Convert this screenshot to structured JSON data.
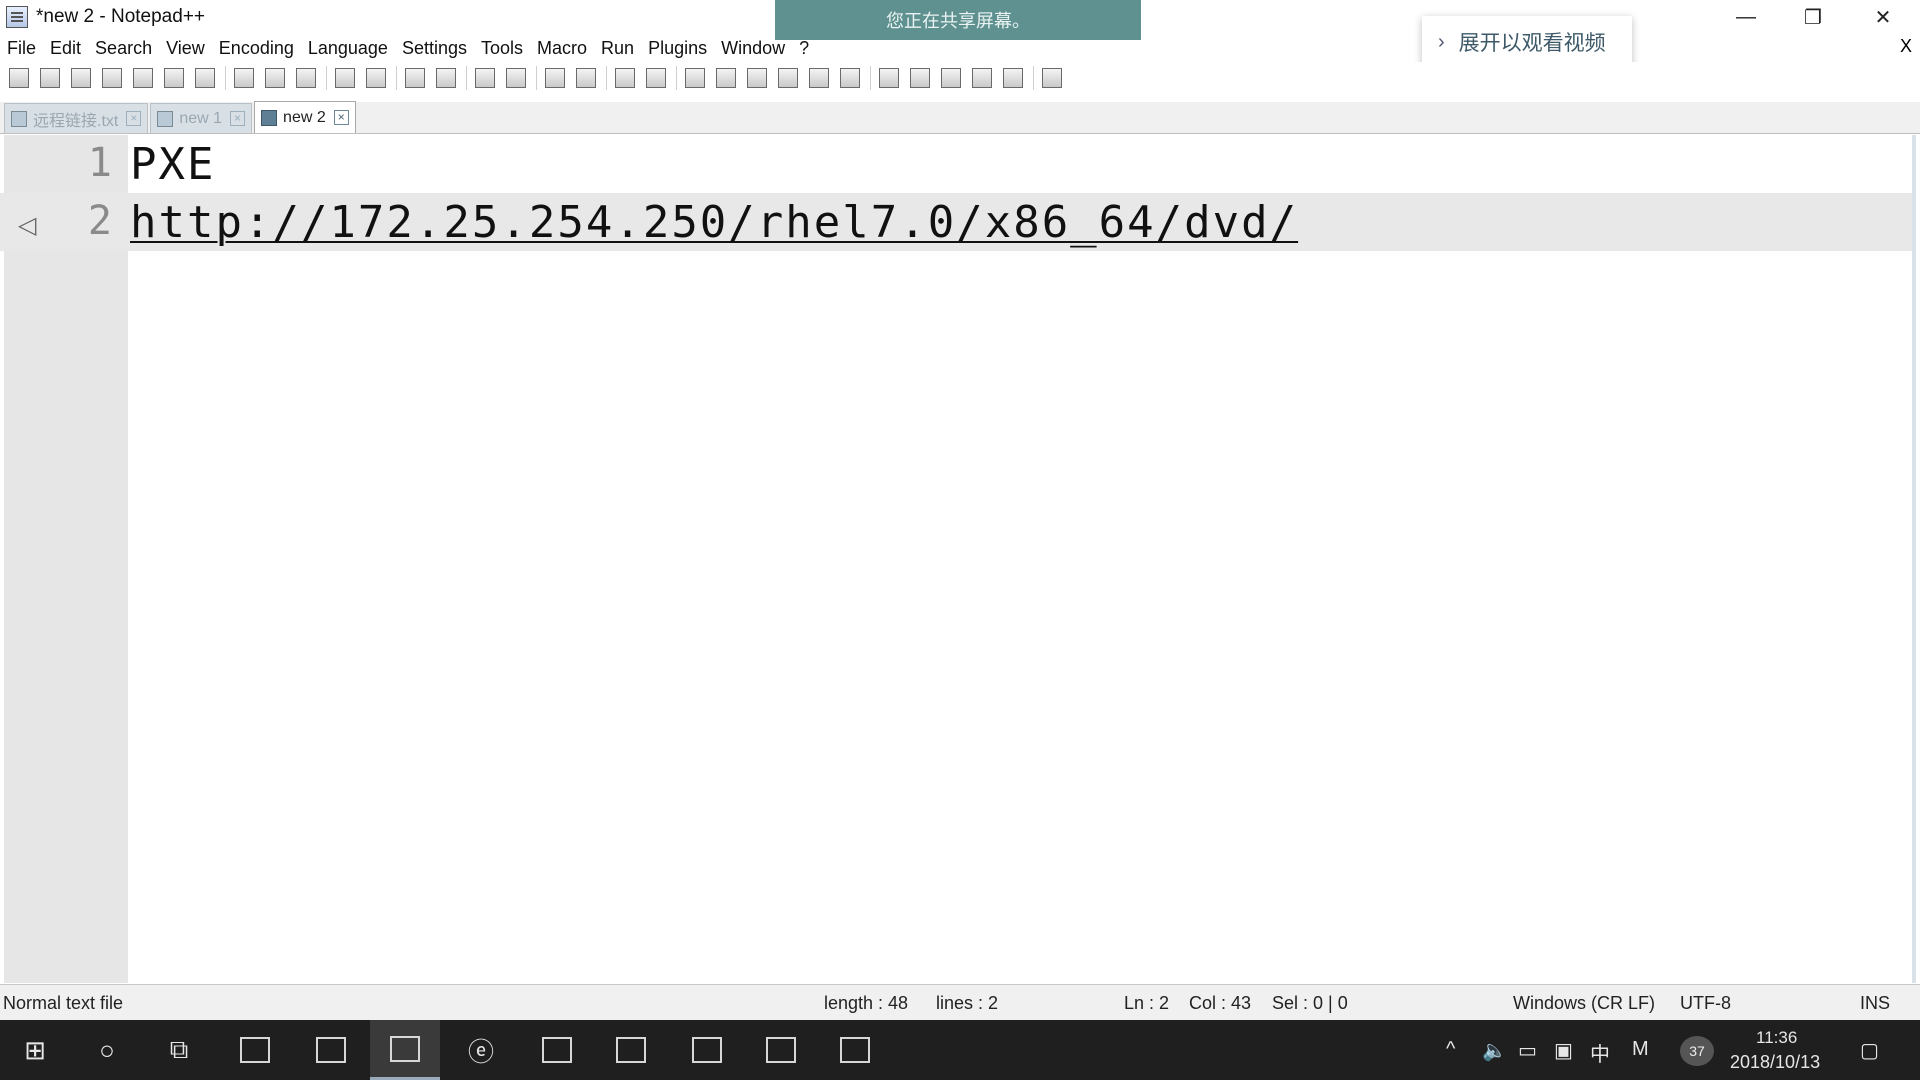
{
  "window": {
    "title": "*new 2 - Notepad++",
    "share_banner": "您正在共享屏幕。",
    "minimize": "—",
    "maximize": "❐",
    "close": "✕"
  },
  "menu": {
    "items": [
      "File",
      "Edit",
      "Search",
      "View",
      "Encoding",
      "Language",
      "Settings",
      "Tools",
      "Macro",
      "Run",
      "Plugins",
      "Window",
      "?"
    ],
    "close_label": "X"
  },
  "overlay": {
    "expand_video_label": "展开以观看视频"
  },
  "toolbar": {
    "icons": [
      "new-file-icon",
      "open-file-icon",
      "save-icon",
      "save-all-icon",
      "close-icon",
      "close-all-icon",
      "print-icon",
      "cut-icon",
      "copy-icon",
      "paste-icon",
      "undo-icon",
      "redo-icon",
      "find-icon",
      "replace-icon",
      "zoom-in-icon",
      "zoom-out-icon",
      "sync-vertical-icon",
      "sync-horizontal-icon",
      "word-wrap-icon",
      "show-all-chars-icon",
      "indent-guide-icon",
      "doc-map-icon",
      "function-list-icon",
      "folder-workspace-icon",
      "monitor-icon",
      "record-macro-icon",
      "stop-macro-icon",
      "play-macro-icon",
      "run-macro-multiple-icon",
      "save-macro-icon",
      "spell-check-icon"
    ]
  },
  "tabs": [
    {
      "label": "远程链接.txt",
      "active": false
    },
    {
      "label": "new 1",
      "active": false
    },
    {
      "label": "new 2",
      "active": true
    }
  ],
  "editor": {
    "lines": [
      {
        "number": "1",
        "text": "PXE"
      },
      {
        "number": "2",
        "text": "http://172.25.254.250/rhel7.0/x86_64/dvd/"
      }
    ]
  },
  "status": {
    "file_type": "Normal text file",
    "length": "length : 48",
    "lines": "lines : 2",
    "ln": "Ln : 2",
    "col": "Col : 43",
    "sel": "Sel : 0 | 0",
    "eol": "Windows (CR LF)",
    "encoding": "UTF-8",
    "mode": "INS"
  },
  "taskbar": {
    "ime": "中",
    "ime_mode": "M",
    "notification_count": "37",
    "time": "11:36",
    "date": "2018/10/13"
  }
}
